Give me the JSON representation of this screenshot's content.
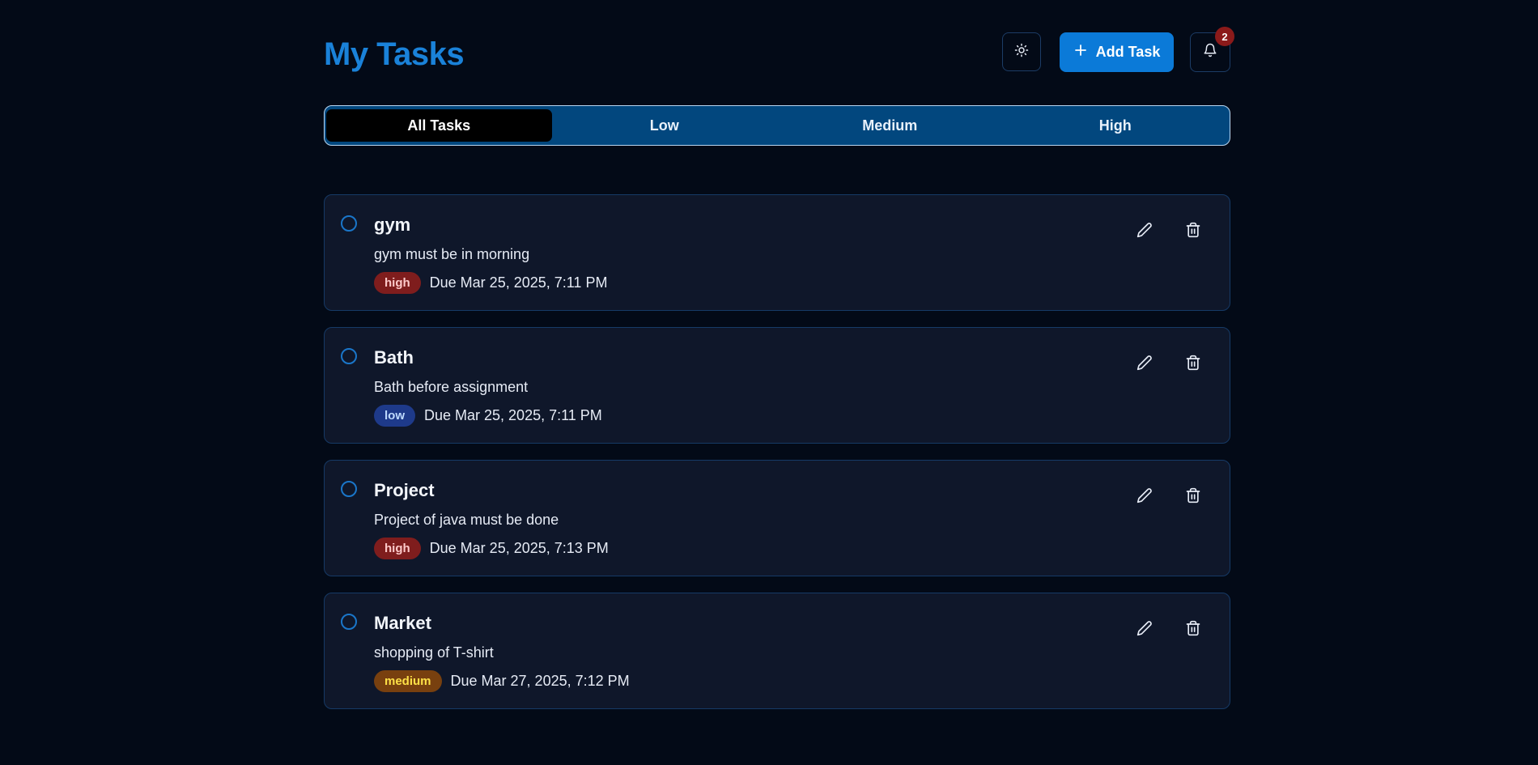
{
  "header": {
    "title": "My Tasks",
    "add_task_label": "Add Task",
    "notification_count": "2"
  },
  "tabs": [
    {
      "label": "All Tasks",
      "active": true
    },
    {
      "label": "Low",
      "active": false
    },
    {
      "label": "Medium",
      "active": false
    },
    {
      "label": "High",
      "active": false
    }
  ],
  "tasks": [
    {
      "title": "gym",
      "description": "gym must be in morning",
      "priority": "high",
      "due": "Due Mar 25, 2025, 7:11 PM"
    },
    {
      "title": "Bath",
      "description": "Bath before assignment",
      "priority": "low",
      "due": "Due Mar 25, 2025, 7:11 PM"
    },
    {
      "title": "Project",
      "description": "Project of java must be done",
      "priority": "high",
      "due": "Due Mar 25, 2025, 7:13 PM"
    },
    {
      "title": "Market",
      "description": "shopping of T-shirt",
      "priority": "medium",
      "due": "Due Mar 27, 2025, 7:12 PM"
    }
  ],
  "colors": {
    "background": "#030a17",
    "accent": "#0b7ad8",
    "title": "#1a82d9",
    "tab_bar": "#02477e",
    "card": "#0f172a",
    "priority_high": "#7f1d1d",
    "priority_low": "#1e3a8a",
    "priority_medium": "#78400f"
  },
  "icons": {
    "theme": "sun-icon",
    "add": "plus-icon",
    "notifications": "bell-icon",
    "edit": "pencil-icon",
    "delete": "trash-icon",
    "complete": "circle-checkbox-icon"
  }
}
